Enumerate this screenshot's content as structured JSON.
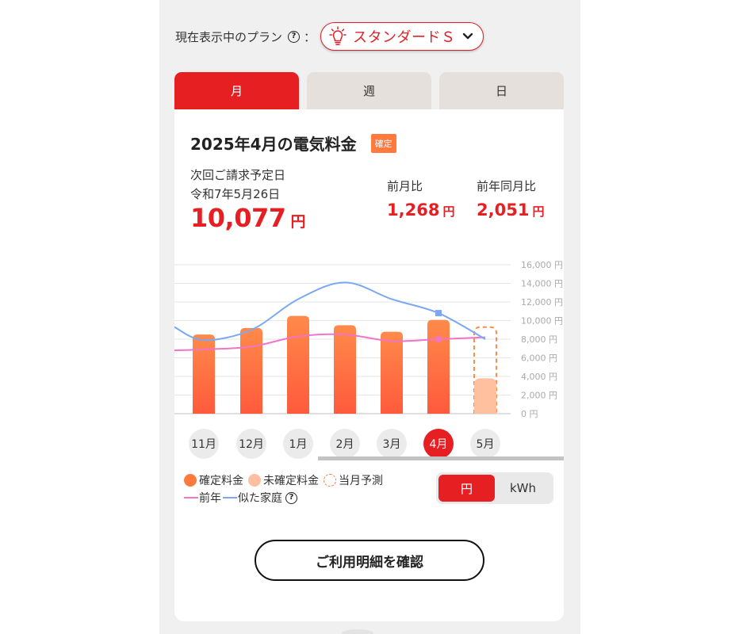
{
  "plan": {
    "label": "現在表示中のプラン",
    "help": "?",
    "colon": "：",
    "current": "スタンダードＳ"
  },
  "tabs": [
    {
      "label": "月",
      "active": true
    },
    {
      "label": "週",
      "active": false
    },
    {
      "label": "日",
      "active": false
    }
  ],
  "summary": {
    "title": "2025年4月の電気料金",
    "badge": "確定",
    "next_label": "次回ご請求予定日",
    "next_date": "令和7年5月26日",
    "amount": "10,077",
    "unit": "円",
    "mom_label": "前月比",
    "mom_value": "1,268",
    "yoy_label": "前年同月比",
    "yoy_value": "2,051"
  },
  "chart_data": {
    "type": "bar",
    "categories": [
      "11月",
      "12月",
      "1月",
      "2月",
      "3月",
      "4月",
      "5月"
    ],
    "series": [
      {
        "name": "確定料金",
        "values": [
          8500,
          9200,
          10500,
          9500,
          8800,
          10077,
          null
        ]
      },
      {
        "name": "未確定料金",
        "values": [
          null,
          null,
          null,
          null,
          null,
          null,
          3800
        ]
      },
      {
        "name": "当月予測",
        "values": [
          null,
          null,
          null,
          null,
          null,
          null,
          9300
        ]
      },
      {
        "name": "前年",
        "values": [
          6900,
          7200,
          8300,
          8500,
          7800,
          8000,
          8200
        ]
      },
      {
        "name": "似た家庭",
        "values": [
          7900,
          9000,
          12300,
          14100,
          12300,
          10800,
          8000
        ]
      }
    ],
    "y_ticks": [
      "16,000 円",
      "14,000 円",
      "12,000 円",
      "10,000 円",
      "8,000 円",
      "6,000 円",
      "4,000 円",
      "2,000 円",
      "0 円"
    ],
    "ylim": [
      0,
      16000
    ],
    "selected": "4月",
    "colors": {
      "bar_top": "#ff8a4a",
      "bar_bottom": "#ff5a3c",
      "bar_unconfirmed": "#ffc0a0",
      "forecast": "#ff8a4a",
      "prev_year": "#f074c8",
      "similar": "#7aa8f5"
    }
  },
  "legend": {
    "confirmed": "確定料金",
    "unconfirmed": "未確定料金",
    "forecast": "当月予測",
    "prev_year": "前年",
    "similar": "似た家庭",
    "help": "?"
  },
  "unit_toggle": [
    {
      "label": "円",
      "active": true
    },
    {
      "label": "kWh",
      "active": false
    }
  ],
  "detail_button": "ご利用明細を確認"
}
